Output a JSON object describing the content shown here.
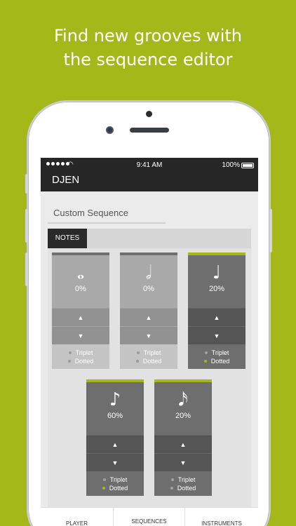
{
  "headline": {
    "line1": "Find new grooves with",
    "line2": "the sequence editor"
  },
  "status_bar": {
    "time": "9:41 AM",
    "battery": "100%"
  },
  "app": {
    "title": "DJEN"
  },
  "sequence": {
    "name": "Custom Sequence"
  },
  "tabs": {
    "notes": "NOTES"
  },
  "notes": [
    {
      "glyph": "𝅝",
      "icon": "whole-note-icon",
      "percent": "0%",
      "active": false,
      "triplet": "Triplet",
      "dotted": "Dotted",
      "dotted_on": false
    },
    {
      "glyph": "𝅗𝅥",
      "icon": "half-note-icon",
      "percent": "0%",
      "active": false,
      "triplet": "Triplet",
      "dotted": "Dotted",
      "dotted_on": false
    },
    {
      "glyph": "♩",
      "icon": "quarter-note-icon",
      "percent": "20%",
      "active": true,
      "triplet": "Triplet",
      "dotted": "Dotted",
      "dotted_on": true
    },
    {
      "glyph": "♪",
      "icon": "eighth-note-icon",
      "percent": "60%",
      "active": true,
      "triplet": "Triplet",
      "dotted": "Dotted",
      "dotted_on": true
    },
    {
      "glyph": "𝅘𝅥𝅯",
      "icon": "sixteenth-note-icon",
      "percent": "20%",
      "active": true,
      "triplet": "Triplet",
      "dotted": "Dotted",
      "dotted_on": false
    }
  ],
  "controls": {
    "up": "▲",
    "down": "▼"
  },
  "bottom_nav": {
    "player": "PLAYER",
    "sequences": "SEQUENCES",
    "instruments": "INSTRUMENTS"
  },
  "colors": {
    "brand_green": "#a4b81a",
    "dark_bar": "#262626"
  }
}
